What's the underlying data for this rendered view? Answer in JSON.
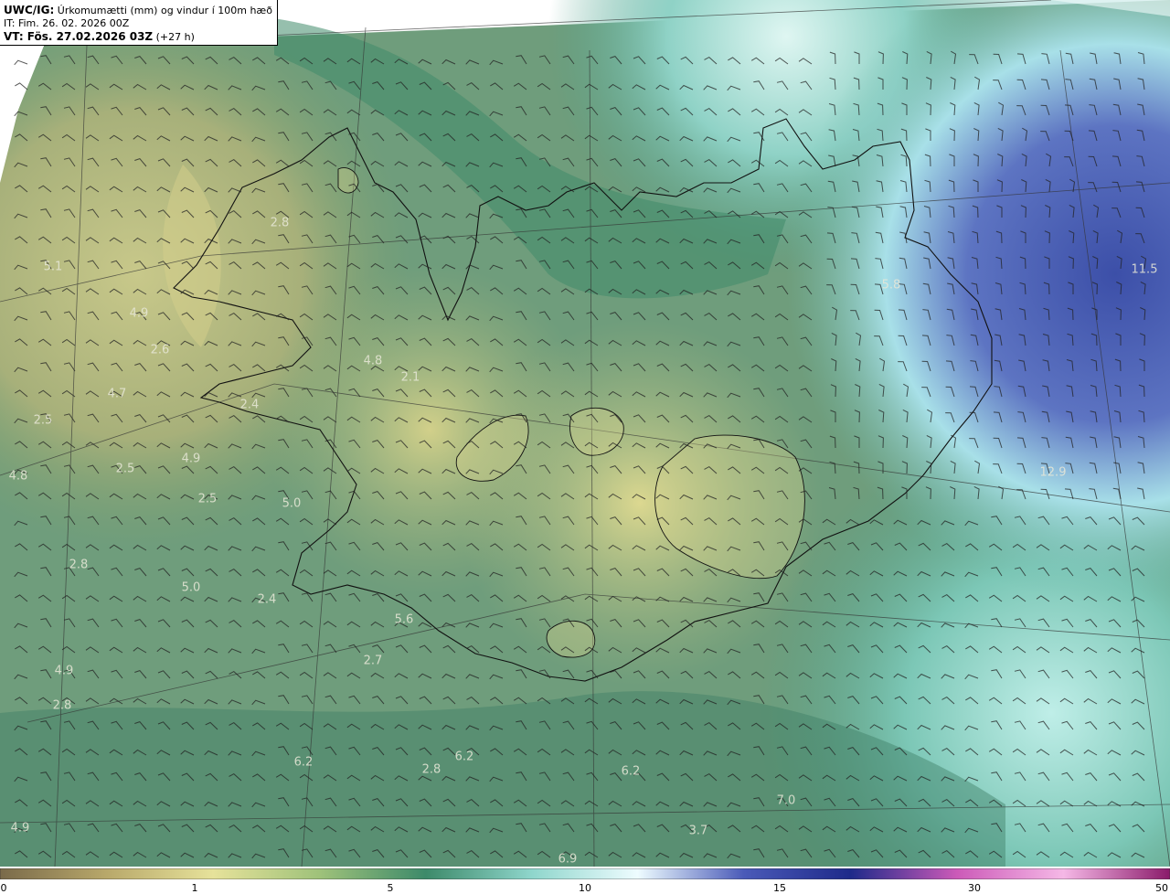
{
  "header": {
    "product": "UWC/IG:",
    "title": "Úrkomumætti (mm) og vindur í 100m hæð",
    "init_time": "IT: Fim. 26. 02. 2026 00Z",
    "valid_prefix": "VT: Fös. 27.02.2026 03Z",
    "lead": "(+27 h)"
  },
  "value_labels": [
    "5.1",
    "4.9",
    "2.6",
    "4.7",
    "2.5",
    "4.8",
    "2.5",
    "2.5",
    "4.9",
    "5.0",
    "2.8",
    "5.0",
    "2.4",
    "4.9",
    "2.8",
    "2.8",
    "4.8",
    "2.1",
    "2.4",
    "5.6",
    "2.7",
    "6.2",
    "2.8",
    "6.2",
    "6.2",
    "6.9",
    "3.7",
    "7.0",
    "5.8",
    "11.5",
    "12.9",
    "4.9"
  ],
  "colorbar": {
    "ticks": [
      "0",
      "1",
      "5",
      "10",
      "15",
      "30",
      "50"
    ],
    "colors": [
      "#7a6a4a",
      "#b8a86a",
      "#e6e29a",
      "#9fc27a",
      "#3d8a6a",
      "#8fd6cc",
      "#eefcff",
      "#4a5ab8",
      "#1e2a8a",
      "#cc5ab8",
      "#f5b8e6",
      "#8a1a6a"
    ]
  }
}
